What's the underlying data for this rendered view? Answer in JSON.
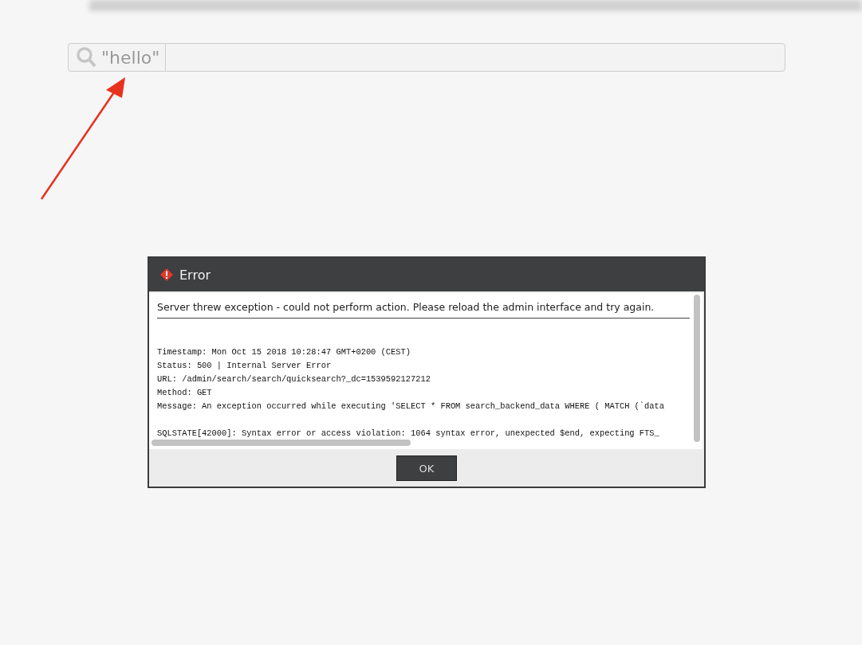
{
  "search": {
    "value": "\"hello\""
  },
  "dialog": {
    "title": "Error",
    "summary": "Server threw exception - could not perform action. Please reload the admin interface and try again.",
    "details": [
      "Timestamp: Mon Oct 15 2018 10:28:47 GMT+0200 (CEST)",
      "Status: 500 | Internal Server Error",
      "URL: /admin/search/search/quicksearch?_dc=1539592127212",
      "Method: GET",
      "Message: An exception occurred while executing 'SELECT * FROM search_backend_data WHERE ( MATCH (`data"
    ],
    "sql_error": "SQLSTATE[42000]: Syntax error or access violation: 1064 syntax error, unexpected $end, expecting FTS_",
    "buttons": [
      "OK"
    ]
  }
}
